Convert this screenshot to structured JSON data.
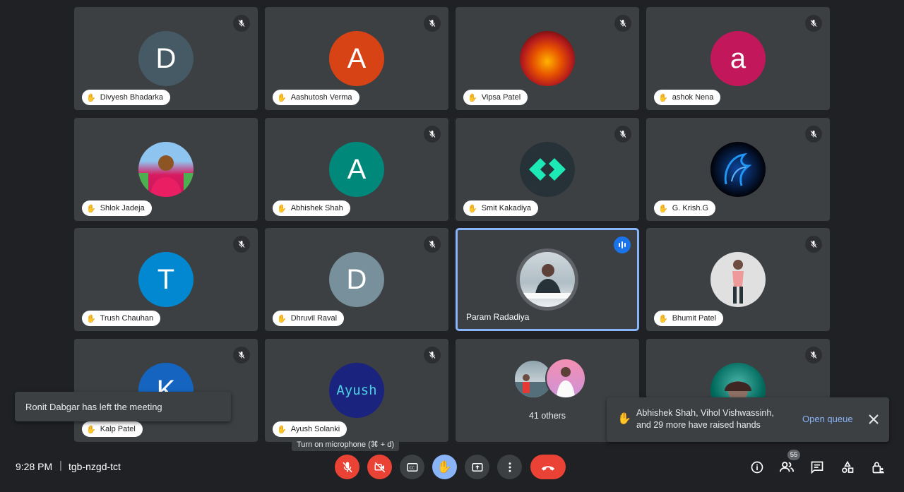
{
  "participants": [
    {
      "name": "Divyesh Bhadarka",
      "initial": "D",
      "color": "#455a64"
    },
    {
      "name": "Aashutosh Verma",
      "initial": "A",
      "color": "#d84315"
    },
    {
      "name": "Vipsa Patel",
      "initial": "",
      "avatar_icon": "fire-horse-photo"
    },
    {
      "name": "ashok Nena",
      "initial": "a",
      "color": "#c2185b"
    },
    {
      "name": "Shlok Jadeja",
      "initial": "",
      "avatar_icon": "person-photo"
    },
    {
      "name": "Abhishek Shah",
      "initial": "A",
      "color": "#00897b"
    },
    {
      "name": "Smit Kakadiya",
      "initial": "",
      "avatar_icon": "code-logo"
    },
    {
      "name": "G. Krish.G",
      "initial": "",
      "avatar_icon": "blue-dragon-photo"
    },
    {
      "name": "Trush Chauhan",
      "initial": "T",
      "color": "#0288d1"
    },
    {
      "name": "Dhruvil Raval",
      "initial": "D",
      "color": "#78909c"
    },
    {
      "name": "Param Radadiya",
      "initial": "",
      "avatar_icon": "person-photo",
      "speaking": true
    },
    {
      "name": "Bhumit Patel",
      "initial": "",
      "avatar_icon": "person-photo"
    },
    {
      "name": "Kalp Patel",
      "initial": "K",
      "color": "#1565c0"
    },
    {
      "name": "Ayush Solanki",
      "initial": "",
      "avatar_text": "Ayush",
      "color": "#1a237e"
    },
    {
      "name": "",
      "others_label": "41 others"
    },
    {
      "name": "",
      "avatar_icon": "person-photo"
    }
  ],
  "toast": {
    "text": "Ronit Dabgar has left the meeting"
  },
  "raised_hands": {
    "text_line1": "Abhishek Shah, Vihol Vishwassinh,",
    "text_line2": "and 29 more have raised hands",
    "action": "Open queue"
  },
  "tooltip": {
    "text": "Turn on microphone (⌘ + d)"
  },
  "meeting": {
    "time": "9:28 PM",
    "separator": "|",
    "code": "tgb-nzgd-tct"
  },
  "people_count": "55",
  "colors": {
    "background": "#202124",
    "tile": "#3c4043",
    "danger": "#ea4335",
    "accent": "#8ab4f8"
  }
}
